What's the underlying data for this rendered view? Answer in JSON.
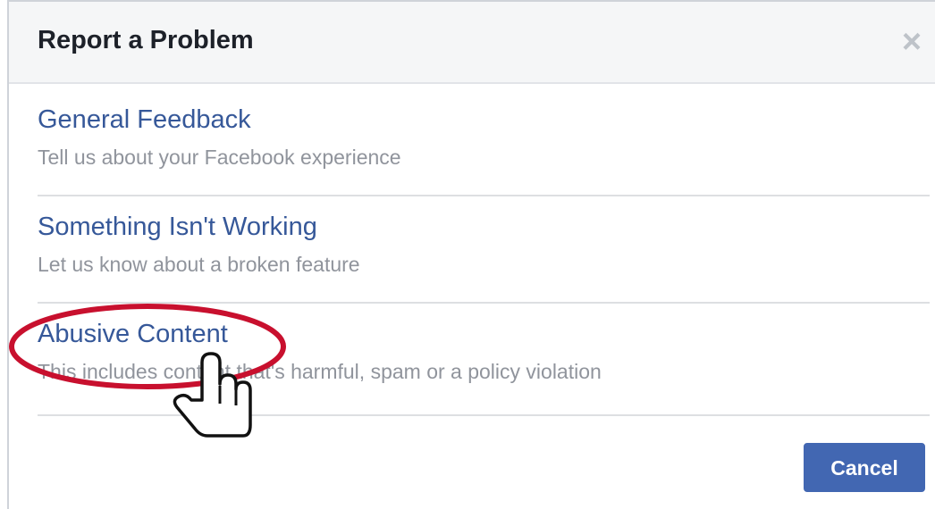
{
  "dialog": {
    "title": "Report a Problem",
    "close_symbol": "×",
    "cancel_label": "Cancel",
    "accent_color": "#4267b2",
    "link_color": "#365899"
  },
  "options": [
    {
      "title": "General Feedback",
      "description": "Tell us about your Facebook experience"
    },
    {
      "title": "Something Isn't Working",
      "description": "Let us know about a broken feature"
    },
    {
      "title": "Abusive Content",
      "description": "This includes content that's harmful, spam or a policy violation"
    }
  ],
  "annotation": {
    "highlight_color": "#c8102e",
    "cursor_icon": "pointing-hand-cursor-icon"
  }
}
